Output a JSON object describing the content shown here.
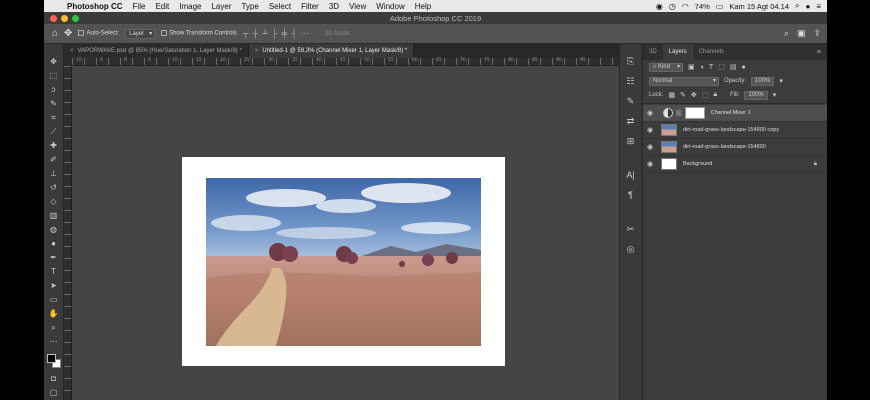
{
  "menubar": {
    "app_name": "Photoshop CC",
    "items": [
      "File",
      "Edit",
      "Image",
      "Layer",
      "Type",
      "Select",
      "Filter",
      "3D",
      "View",
      "Window",
      "Help"
    ],
    "battery": "74%",
    "datetime": "Kam 15 Agt  04.14"
  },
  "window": {
    "title": "Adobe Photoshop CC 2019"
  },
  "options": {
    "auto_select_label": "Auto-Select:",
    "auto_select_value": "Layer",
    "transform_label": "Show Transform Controls",
    "mode_3d": "3D Mode:"
  },
  "tabs": [
    {
      "label": "VAPORWAVE.psd @ 85% (Hue/Saturation 1, Layer Mask/8) *",
      "active": false
    },
    {
      "label": "Untitled-1 @ 59,3% (Channel Mixer 1, Layer Mask/8) *",
      "active": true
    }
  ],
  "ruler_numbers": [
    "10",
    "5",
    "0",
    "5",
    "10",
    "15",
    "20",
    "25",
    "30",
    "35",
    "40",
    "45",
    "50",
    "55",
    "60",
    "65",
    "70",
    "75",
    "80",
    "85",
    "90",
    "95"
  ],
  "layers_panel": {
    "tabs": [
      "3D",
      "Layers",
      "Channels"
    ],
    "filter_kind": "Kind",
    "blend_mode": "Normal",
    "opacity_label": "Opacity:",
    "opacity_value": "100%",
    "lock_label": "Lock:",
    "fill_label": "Fill:",
    "fill_value": "100%",
    "layers": [
      {
        "name": "Channel Mixer 1",
        "type": "adjustment",
        "selected": true
      },
      {
        "name": "dirt-road-grass-landscape-154800 copy",
        "type": "photo",
        "selected": false
      },
      {
        "name": "dirt-road-grass-landscape-154800",
        "type": "photo",
        "selected": false
      },
      {
        "name": "Background",
        "type": "background",
        "selected": false
      }
    ]
  },
  "colors": {
    "foreground": "#000000",
    "background": "#ffffff",
    "ui_dark": "#323232",
    "canvas_bg": "#454545"
  },
  "icons": [
    "apple-icon",
    "move-icon",
    "marquee-icon",
    "lasso-icon",
    "quick-select-icon",
    "crop-icon",
    "eyedropper-icon",
    "healing-icon",
    "brush-icon",
    "stamp-icon",
    "history-brush-icon",
    "eraser-icon",
    "gradient-icon",
    "blur-icon",
    "dodge-icon",
    "pen-icon",
    "type-icon",
    "path-select-icon",
    "rectangle-icon",
    "hand-icon",
    "zoom-icon",
    "more-tools-icon",
    "eye-icon",
    "lock-icon"
  ]
}
